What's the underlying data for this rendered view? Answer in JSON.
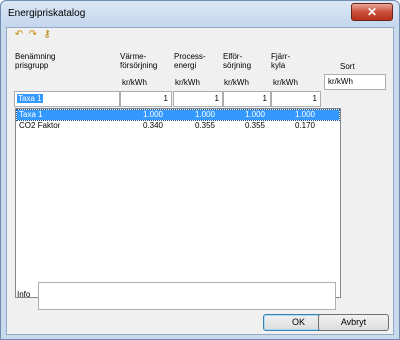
{
  "window": {
    "title": "Energipriskatalog",
    "close_label": "✕"
  },
  "toolbar": [
    {
      "name": "undo-icon",
      "glyph": "↶"
    },
    {
      "name": "redo-icon",
      "glyph": "↷"
    },
    {
      "name": "key-icon",
      "glyph": "⚷"
    }
  ],
  "headers": {
    "name": [
      "Benämning",
      "prisgrupp"
    ],
    "heat": [
      "Värme-",
      "försörjning"
    ],
    "process": [
      "Process-",
      "energi"
    ],
    "electric": [
      "Elför-",
      "sörjning"
    ],
    "cooling": [
      "Fjärr-",
      "kyla"
    ],
    "sort": "Sort"
  },
  "units": {
    "heat": "kr/kWh",
    "process": "kr/kWh",
    "electric": "kr/kWh",
    "cooling": "kr/kWh",
    "sort_value": "kr/kWh"
  },
  "edit_row": {
    "name": "Taxa 1",
    "heat": "1",
    "process": "1",
    "electric": "1",
    "cooling": "1"
  },
  "list": [
    {
      "name": "Taxa 1",
      "heat": "1.000",
      "process": "1.000",
      "electric": "1.000",
      "cooling": "1.000",
      "selected": true
    },
    {
      "name": "CO2 Faktor",
      "heat": "0.340",
      "process": "0.355",
      "electric": "0.355",
      "cooling": "0.170",
      "selected": false
    }
  ],
  "info": {
    "label": "Info",
    "value": ""
  },
  "buttons": {
    "ok": "OK",
    "cancel": "Avbryt"
  }
}
